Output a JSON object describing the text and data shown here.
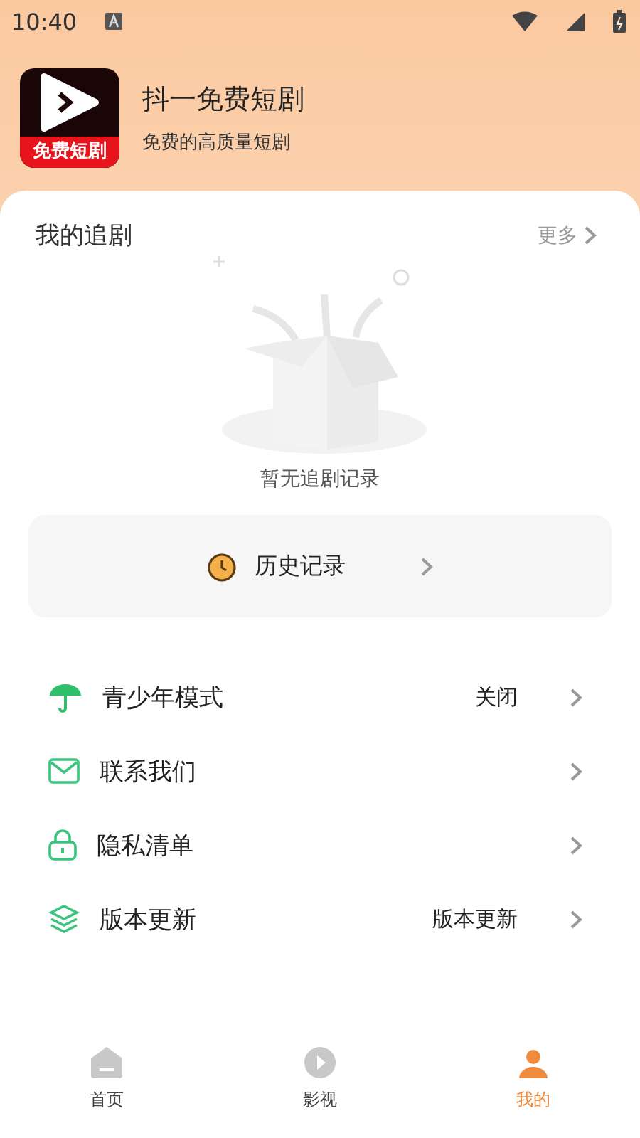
{
  "status_bar": {
    "time": "10:40"
  },
  "app_header": {
    "logo_caption": "免费短剧",
    "title": "抖一免费短剧",
    "subtitle": "免费的高质量短剧"
  },
  "my_series": {
    "title": "我的追剧",
    "more": "更多",
    "empty_text": "暂无追剧记录"
  },
  "history_button": {
    "label": "历史记录"
  },
  "menu": [
    {
      "label": "青少年模式",
      "value": "关闭"
    },
    {
      "label": "联系我们"
    },
    {
      "label": "隐私清单"
    },
    {
      "label": "版本更新",
      "value": "版本更新"
    }
  ],
  "bottom_nav": [
    {
      "label": "首页",
      "selected": false
    },
    {
      "label": "影视",
      "selected": false
    },
    {
      "label": "我的",
      "selected": true
    }
  ]
}
